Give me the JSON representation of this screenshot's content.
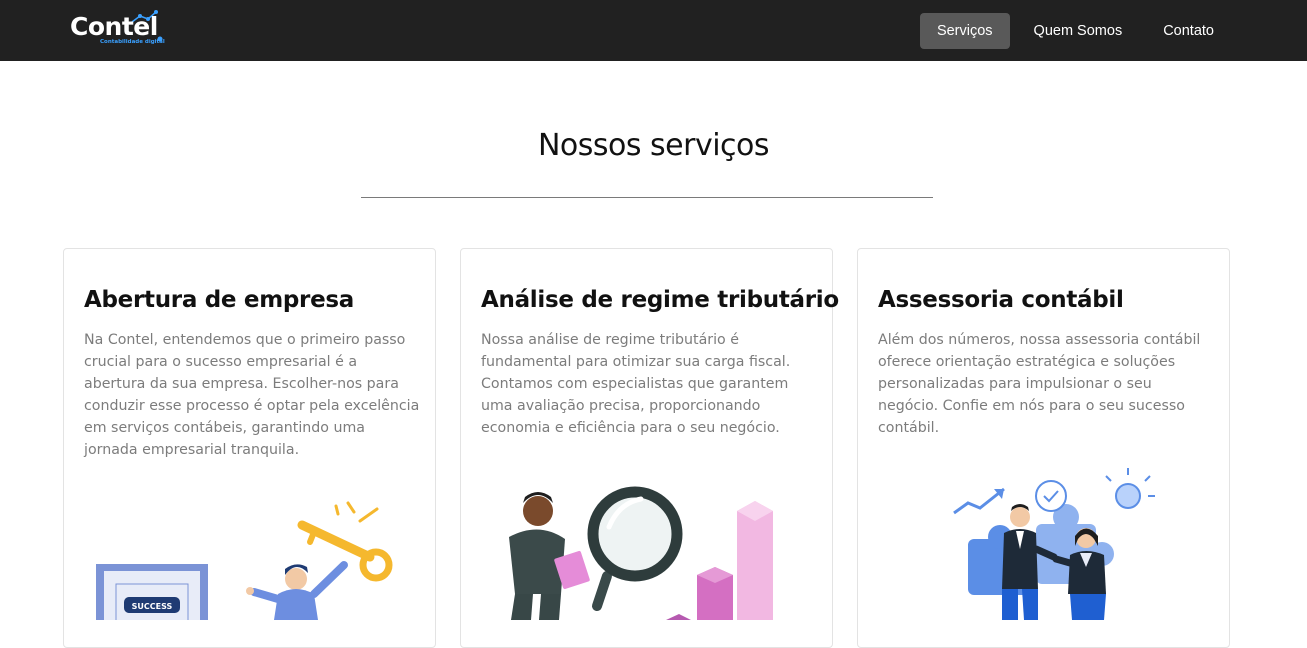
{
  "brand": {
    "name": "Contel",
    "tagline": "Contabilidade digital"
  },
  "nav": {
    "items": [
      {
        "label": "Serviços",
        "active": true
      },
      {
        "label": "Quem Somos",
        "active": false
      },
      {
        "label": "Contato",
        "active": false
      }
    ]
  },
  "services": {
    "title": "Nossos serviços",
    "cards": [
      {
        "title": "Abertura de empresa",
        "text": "Na Contel, entendemos que o primeiro passo crucial para o sucesso empresarial é a abertura da sua empresa. Escolher-nos para conduzir esse processo é optar pela excelência em serviços contábeis, garantindo uma jornada empresarial tranquila.",
        "badge": "SUCCESS"
      },
      {
        "title": "Análise de regime tributário",
        "text": "Nossa análise de regime tributário é fundamental para otimizar sua carga fiscal. Contamos com especialistas que garantem uma avaliação precisa, proporcionando economia e eficiência para o seu negócio."
      },
      {
        "title": "Assessoria contábil",
        "text": "Além dos números, nossa assessoria contábil oferece orientação estratégica e soluções personalizadas para impulsionar o seu negócio. Confie em nós para o seu sucesso contábil."
      }
    ]
  },
  "colors": {
    "navbar": "#212121",
    "active_nav": "#595959",
    "brand_accent": "#3aa0ff"
  }
}
